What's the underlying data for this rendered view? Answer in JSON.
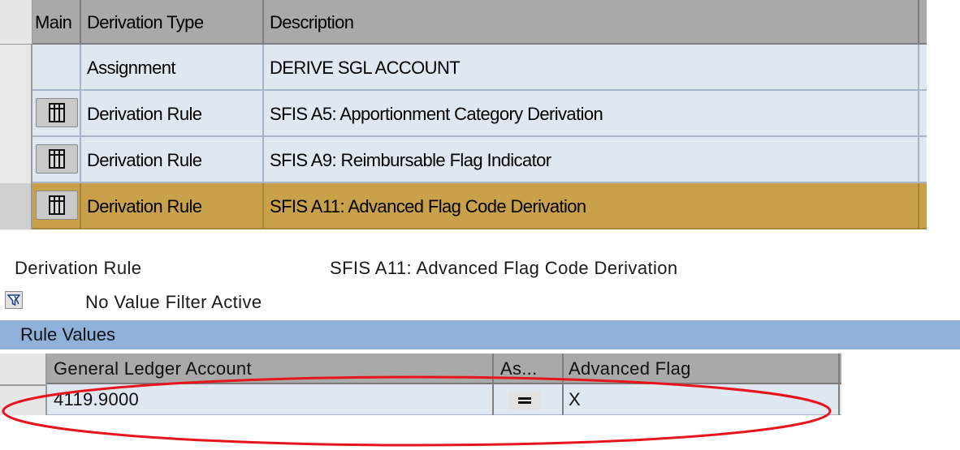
{
  "derivation_steps": {
    "columns": {
      "main": "Main",
      "type": "Derivation Type",
      "description": "Description"
    },
    "rows": [
      {
        "type": "Assignment",
        "description": "DERIVE SGL ACCOUNT",
        "has_button": false,
        "selected": false
      },
      {
        "type": "Derivation Rule",
        "description": "SFIS A5:  Apportionment Category Derivation",
        "has_button": true,
        "selected": false
      },
      {
        "type": "Derivation Rule",
        "description": "SFIS A9:  Reimbursable Flag Indicator",
        "has_button": true,
        "selected": false
      },
      {
        "type": "Derivation Rule",
        "description": "SFIS A11:  Advanced Flag Code Derivation",
        "has_button": true,
        "selected": true
      }
    ]
  },
  "detail": {
    "step_type": "Derivation Rule",
    "step_description": "SFIS A11:  Advanced Flag Code Derivation",
    "filter_status": "No Value Filter Active",
    "section_title": "Rule Values",
    "rule_values": {
      "columns": {
        "gl_account": "General Ledger Account",
        "assign": "As...",
        "advanced_flag": "Advanced Flag"
      },
      "rows": [
        {
          "gl_account": "4119.9000",
          "advanced_flag": "X"
        }
      ]
    }
  },
  "colors": {
    "selected_row": "#c8a14a",
    "row_bg": "#dfe7f0",
    "header_bg": "#a9a9a9",
    "section_bar": "#8fb0d8",
    "annotation": "#e8141c"
  },
  "icons": {
    "row_button": "table-icon",
    "filter": "filter-icon",
    "assign_operator": "equals-icon"
  }
}
